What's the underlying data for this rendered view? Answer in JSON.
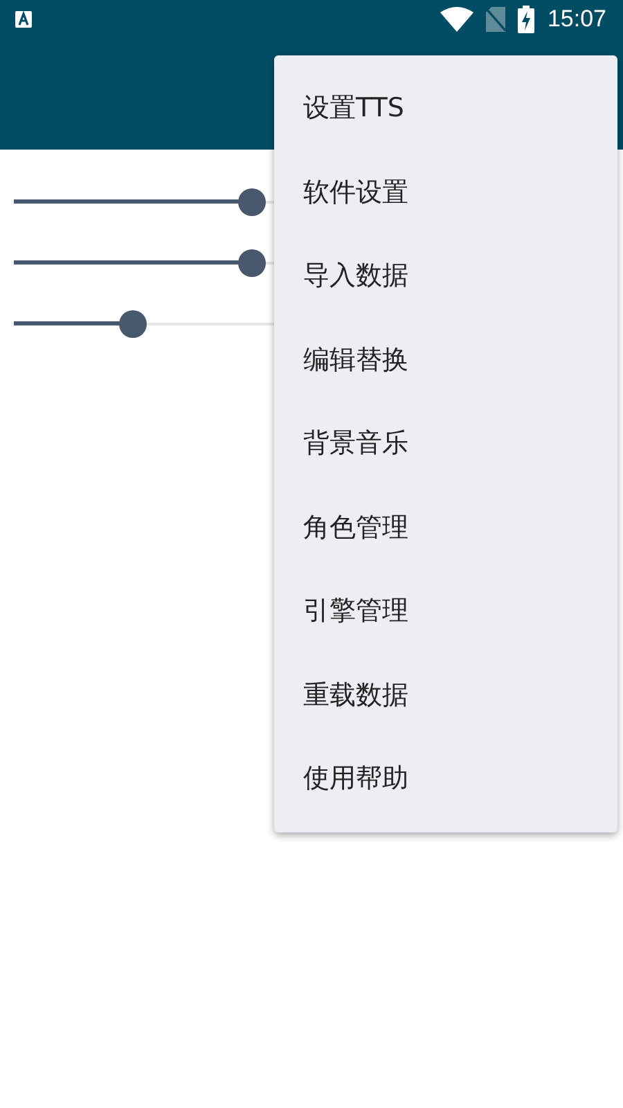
{
  "status_bar": {
    "time": "15:07"
  },
  "sliders": [
    {
      "level": 0.4
    },
    {
      "level": 0.4
    },
    {
      "level": 0.2
    }
  ],
  "menu": {
    "items": [
      {
        "label": "设置TTS"
      },
      {
        "label": "软件设置"
      },
      {
        "label": "导入数据"
      },
      {
        "label": "编辑替换"
      },
      {
        "label": "背景音乐"
      },
      {
        "label": "角色管理"
      },
      {
        "label": "引擎管理"
      },
      {
        "label": "重载数据"
      },
      {
        "label": "使用帮助"
      }
    ]
  }
}
